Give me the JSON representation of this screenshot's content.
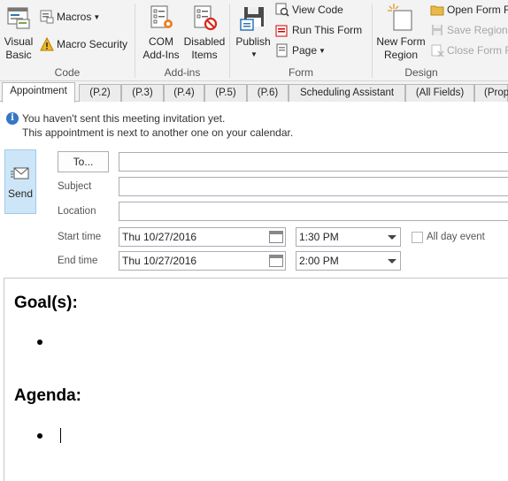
{
  "ribbon": {
    "code_group": {
      "label": "Code",
      "visual_basic": "Visual\nBasic",
      "macros": "Macros",
      "macro_security": "Macro Security"
    },
    "addins_group": {
      "label": "Add-ins",
      "com_addins": "COM\nAdd-Ins",
      "disabled_items": "Disabled\nItems"
    },
    "form_group": {
      "label": "Form",
      "publish": "Publish",
      "view_code": "View Code",
      "run_this_form": "Run This Form",
      "page": "Page"
    },
    "design_group": {
      "label": "Design",
      "new_form_region": "New Form\nRegion",
      "open_form_region": "Open Form R",
      "save_region": "Save Region",
      "close_form_region": "Close Form R"
    }
  },
  "tabs": [
    "Appointment",
    "(P.2)",
    "(P.3)",
    "(P.4)",
    "(P.5)",
    "(P.6)",
    "Scheduling Assistant",
    "(All Fields)",
    "(Prop"
  ],
  "info": {
    "line1": "You haven't sent this meeting invitation yet.",
    "line2": "This appointment is next to another one on your calendar."
  },
  "form": {
    "send": "Send",
    "to_button": "To...",
    "subject_label": "Subject",
    "location_label": "Location",
    "start_label": "Start time",
    "end_label": "End time",
    "start_date": "Thu 10/27/2016",
    "start_time": "1:30 PM",
    "end_date": "Thu 10/27/2016",
    "end_time": "2:00 PM",
    "all_day": "All day event"
  },
  "body": {
    "heading1": "Goal(s):",
    "heading2": "Agenda:"
  },
  "colors": {
    "ribbon_bg": "#f3f3f3",
    "send_bg": "#cde6f7",
    "info_icon": "#3477c4"
  }
}
